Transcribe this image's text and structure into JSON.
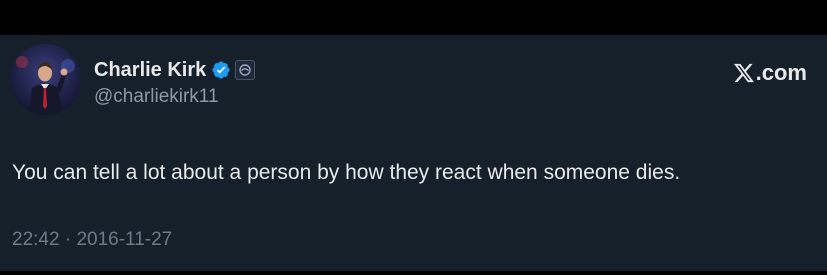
{
  "author": {
    "display_name": "Charlie Kirk",
    "handle": "@charliekirk11",
    "avatar_icon": "profile-photo",
    "verified_icon": "verified-badge-icon",
    "affiliate_icon": "organization-badge-icon"
  },
  "brand": {
    "logo_icon": "x-logo-icon",
    "suffix": ".com"
  },
  "tweet": {
    "text": "You can tell a lot about a person by how they react when someone dies.",
    "time": "22:42",
    "separator": "·",
    "date": "2016-11-27"
  },
  "colors": {
    "page_bg": "#000000",
    "card_bg": "#16202b",
    "primary_text": "#e7e9ea",
    "secondary_text": "#8b98a5",
    "verified_blue": "#1d9bf0"
  }
}
